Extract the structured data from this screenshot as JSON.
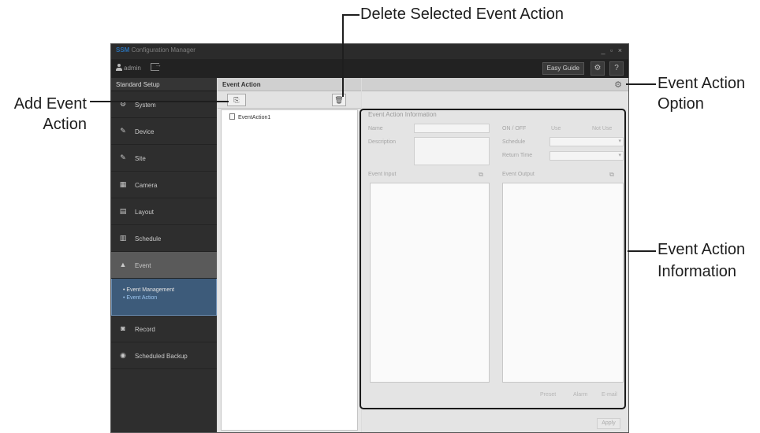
{
  "callouts": {
    "delete": "Delete Selected Event Action",
    "add_line1": "Add Event",
    "add_line2": "Action",
    "option_line1": "Event Action",
    "option_line2": "Option",
    "info_line1": "Event Action",
    "info_line2": "Information"
  },
  "app": {
    "title_brand": "SSM",
    "title_rest": " Configuration Manager",
    "window_controls": "_ ▫ ×",
    "user": "admin",
    "easy_guide": "Easy Guide",
    "settings_glyph": "⚙",
    "help_glyph": "?"
  },
  "sidebar": {
    "header": "Standard Setup",
    "items": [
      {
        "label": "System",
        "icon": "system-icon",
        "glyph": "⚙"
      },
      {
        "label": "Device",
        "icon": "device-icon",
        "glyph": "✎"
      },
      {
        "label": "Site",
        "icon": "site-icon",
        "glyph": "✎"
      },
      {
        "label": "Camera",
        "icon": "camera-icon",
        "glyph": "▦"
      },
      {
        "label": "Layout",
        "icon": "layout-icon",
        "glyph": "▤"
      },
      {
        "label": "Schedule",
        "icon": "schedule-icon",
        "glyph": "▥"
      },
      {
        "label": "Event",
        "icon": "event-icon",
        "glyph": "▲"
      },
      {
        "label": "Record",
        "icon": "record-icon",
        "glyph": "◙"
      },
      {
        "label": "Scheduled Backup",
        "icon": "backup-icon",
        "glyph": "◉"
      }
    ],
    "event_sub": [
      "•  Event Management",
      "•  Event Action"
    ]
  },
  "event_action": {
    "title": "Event Action",
    "add_glyph": "⎘",
    "delete_glyph": "🗑",
    "items": [
      "EventAction1"
    ]
  },
  "info": {
    "option_glyph": "⚙",
    "section_title": "Event Action Information",
    "name_label": "Name",
    "description_label": "Description",
    "onoff_label": "ON / OFF",
    "on_text": "Use",
    "off_text": "Not Use",
    "schedule_label": "Schedule",
    "return_time_label": "Return Time",
    "event_input_label": "Event Input",
    "event_output_label": "Event Output",
    "bottom_buttons": [
      "Preset",
      "Alarm",
      "E-mail"
    ],
    "apply": "Apply"
  }
}
